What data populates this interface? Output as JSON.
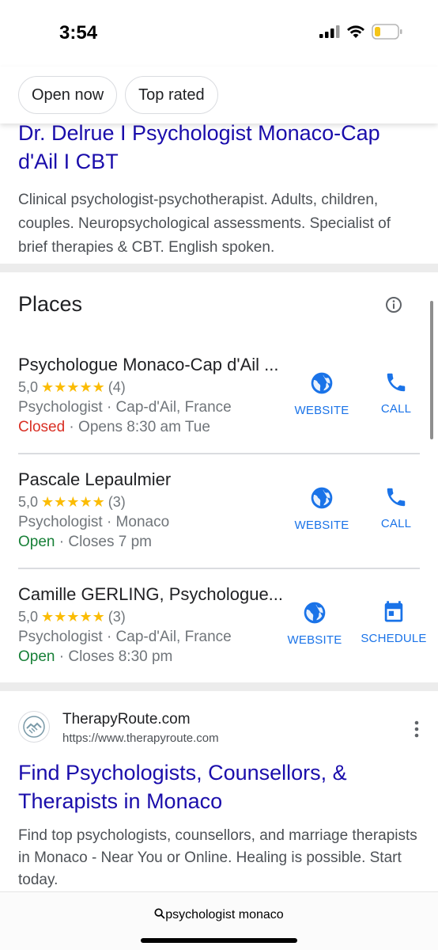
{
  "status": {
    "time": "3:54"
  },
  "chips": [
    "Open now",
    "Top rated"
  ],
  "result1": {
    "title": "Dr. Delrue I Psychologist Monaco-Cap d'Ail I CBT",
    "description": "Clinical psychologist-psychotherapist. Adults, children, couples. Neuropsychological assessments. Specialist of brief therapies & CBT. English spoken."
  },
  "places": {
    "title": "Places",
    "items": [
      {
        "name": "Psychologue Monaco-Cap d'Ail ...",
        "rating": "5,0",
        "stars": "★★★★★",
        "reviews": "(4)",
        "category": "Psychologist · Cap-d'Ail, France",
        "status": "Closed",
        "hours": " · Opens 8:30 am Tue",
        "action1": "WEBSITE",
        "action2": "CALL"
      },
      {
        "name": "Pascale Lepaulmier",
        "rating": "5,0",
        "stars": "★★★★★",
        "reviews": "(3)",
        "category": "Psychologist · Monaco",
        "status": "Open",
        "hours": " · Closes 7 pm",
        "action1": "WEBSITE",
        "action2": "CALL"
      },
      {
        "name": "Camille GERLING, Psychologue...",
        "rating": "5,0",
        "stars": "★★★★★",
        "reviews": "(3)",
        "category": "Psychologist · Cap-d'Ail, France",
        "status": "Open",
        "hours": " · Closes 8:30 pm",
        "action1": "WEBSITE",
        "action2": "SCHEDULE"
      }
    ]
  },
  "result2": {
    "site_name": "TherapyRoute.com",
    "url": "https://www.therapyroute.com",
    "title": "Find Psychologists, Counsellors, & Therapists in Monaco",
    "description": "Find top psychologists, counsellors, and marriage therapists in Monaco - Near You or Online. Healing is possible. Start today."
  },
  "address_bar": {
    "query": "psychologist monaco"
  },
  "colors": {
    "link": "#1a0dab",
    "accent": "#1a73e8",
    "closed": "#d93025",
    "open": "#188038",
    "star": "#fbbc04"
  }
}
